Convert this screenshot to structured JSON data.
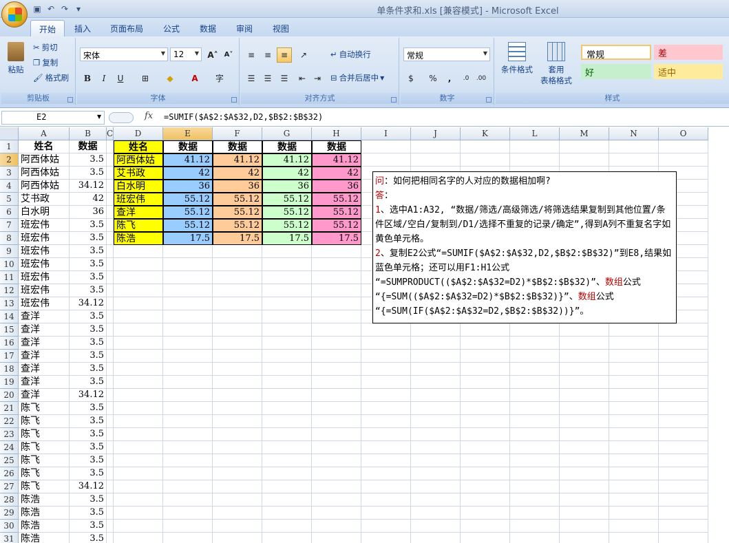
{
  "window": {
    "title": "单条件求和.xls  [兼容模式] - Microsoft Excel"
  },
  "tabs": [
    "开始",
    "插入",
    "页面布局",
    "公式",
    "数据",
    "审阅",
    "视图"
  ],
  "ribbon": {
    "clipboard": {
      "paste": "粘贴",
      "cut": "剪切",
      "copy": "复制",
      "format_painter": "格式刷",
      "label": "剪贴板"
    },
    "font": {
      "name": "宋体",
      "size": "12",
      "label": "字体"
    },
    "alignment": {
      "wrap": "自动换行",
      "merge": "合并后居中",
      "label": "对齐方式"
    },
    "number": {
      "format": "常规",
      "label": "数字"
    },
    "styles": {
      "conditional": "条件格式",
      "table_line1": "套用",
      "table_line2": "表格格式",
      "cells": [
        "常规",
        "差",
        "好",
        "适中"
      ],
      "label": "样式"
    }
  },
  "formula_bar": {
    "name_box": "E2",
    "fx": "fx",
    "formula": "=SUMIF($A$2:$A$32,D2,$B$2:$B$32)"
  },
  "columns": [
    "A",
    "B",
    "C",
    "D",
    "E",
    "F",
    "G",
    "H",
    "I",
    "J",
    "K",
    "L",
    "M",
    "N",
    "O"
  ],
  "rows": [
    "1",
    "2",
    "3",
    "4",
    "5",
    "6",
    "7",
    "8",
    "9",
    "10",
    "11",
    "12",
    "13",
    "14",
    "15",
    "16",
    "17",
    "18",
    "19",
    "20",
    "21",
    "22",
    "23",
    "24",
    "25",
    "26",
    "27",
    "28",
    "29",
    "30",
    "31"
  ],
  "colA": [
    "姓名",
    "阿西体姑",
    "阿西体姑",
    "阿西体姑",
    "艾书政",
    "白水明",
    "班宏伟",
    "班宏伟",
    "班宏伟",
    "班宏伟",
    "班宏伟",
    "班宏伟",
    "班宏伟",
    "查洋",
    "查洋",
    "查洋",
    "查洋",
    "查洋",
    "查洋",
    "查洋",
    "陈飞",
    "陈飞",
    "陈飞",
    "陈飞",
    "陈飞",
    "陈飞",
    "陈飞",
    "陈浩",
    "陈浩",
    "陈浩",
    "陈浩"
  ],
  "colB": [
    "数据",
    "3.5",
    "3.5",
    "34.12",
    "42",
    "36",
    "3.5",
    "3.5",
    "3.5",
    "3.5",
    "3.5",
    "3.5",
    "34.12",
    "3.5",
    "3.5",
    "3.5",
    "3.5",
    "3.5",
    "3.5",
    "34.12",
    "3.5",
    "3.5",
    "3.5",
    "3.5",
    "3.5",
    "3.5",
    "34.12",
    "3.5",
    "3.5",
    "3.5",
    "3.5"
  ],
  "summary": {
    "headers": [
      "姓名",
      "数据",
      "数据",
      "数据",
      "数据"
    ],
    "rows": [
      [
        "阿西体姑",
        "41.12",
        "41.12",
        "41.12",
        "41.12"
      ],
      [
        "艾书政",
        "42",
        "42",
        "42",
        "42"
      ],
      [
        "白水明",
        "36",
        "36",
        "36",
        "36"
      ],
      [
        "班宏伟",
        "55.12",
        "55.12",
        "55.12",
        "55.12"
      ],
      [
        "查洋",
        "55.12",
        "55.12",
        "55.12",
        "55.12"
      ],
      [
        "陈飞",
        "55.12",
        "55.12",
        "55.12",
        "55.12"
      ],
      [
        "陈浩",
        "17.5",
        "17.5",
        "17.5",
        "17.5"
      ]
    ]
  },
  "textbox": {
    "q_mark": "问",
    "q_text": "：如何把相同名字的人对应的数据相加啊?",
    "a_mark": "答",
    "a_colon": "：",
    "n1": "1",
    "s1": "、选中A1:A32, “数据/筛选/高级筛选/将筛选结果复制到其他位置/条件区域/空白/复制到/D1/选择不重复的记录/确定”,得到A列不重复名字如黄色单元格。",
    "n2": "2",
    "s2a": "、复制E2公式“=SUMIF($A$2:$A$32,D2,$B$2:$B$32)”到E8,结果如蓝色单元格；还可以用F1:H1公式",
    "s2b": "“=SUMPRODUCT(($A$2:$A$32=D2)*$B$2:$B$32)”、",
    "array1": "数组",
    "s2c": "公式",
    "s2d": "“{=SUM(($A$2:$A$32=D2)*$B$2:$B$32)}”、",
    "array2": "数组",
    "s2e": "公式",
    "s2f": "“{=SUM(IF($A$2:$A$32=D2,$B$2:$B$32))}”。"
  }
}
